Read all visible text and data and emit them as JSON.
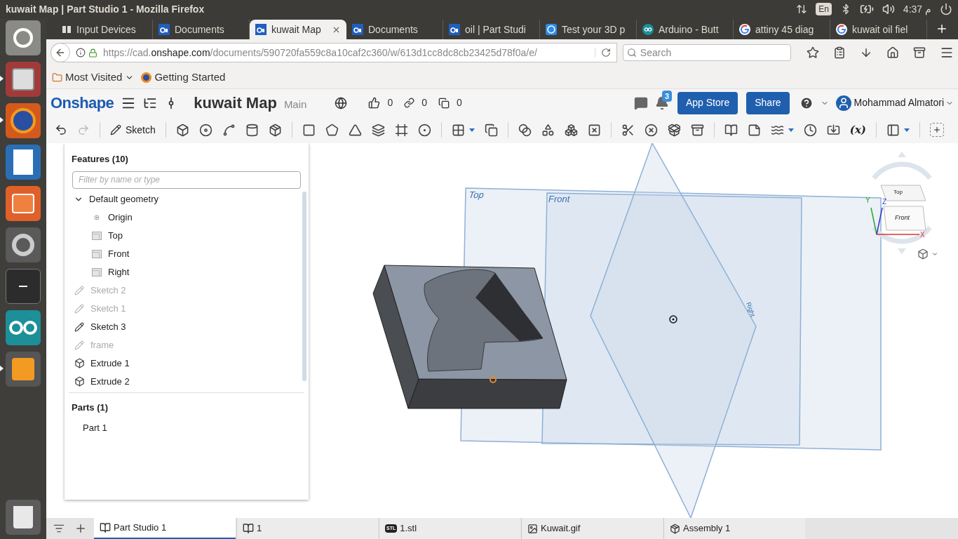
{
  "os_bar": {
    "title": "kuwait Map | Part Studio 1 - Mozilla Firefox",
    "keyboard": "En",
    "clock": "4:37 م"
  },
  "launcher": [
    {
      "kind": "dash",
      "running": false
    },
    {
      "kind": "files",
      "running": true
    },
    {
      "kind": "firefox",
      "running": true
    },
    {
      "kind": "writer",
      "running": false
    },
    {
      "kind": "store",
      "running": false
    },
    {
      "kind": "settings",
      "running": false
    },
    {
      "kind": "terminal",
      "running": false
    },
    {
      "kind": "arduino",
      "running": false
    },
    {
      "kind": "sublime",
      "running": true
    },
    {
      "kind": "trash",
      "running": false
    }
  ],
  "browser_tabs": [
    {
      "label": "Input Devices",
      "kind": "devices",
      "selected": false
    },
    {
      "label": "Documents",
      "kind": "onshape",
      "selected": false
    },
    {
      "label": "kuwait Map",
      "kind": "onshape",
      "selected": true
    },
    {
      "label": "Documents",
      "kind": "onshape",
      "selected": false
    },
    {
      "label": "oil | Part Studi",
      "kind": "onshape",
      "selected": false
    },
    {
      "label": "Test your 3D p",
      "kind": "badge",
      "selected": false
    },
    {
      "label": "Arduino - Butt",
      "kind": "arduino",
      "selected": false
    },
    {
      "label": "attiny 45 diag",
      "kind": "google",
      "selected": false
    },
    {
      "label": "kuwait oil fiel",
      "kind": "google",
      "selected": false
    }
  ],
  "address": {
    "scheme": "https://cad.",
    "host": "onshape.com",
    "path": "/documents/590720fa559c8a10caf2c360/w/613d1cc8dc8cb23425d78f0a/e/"
  },
  "search_placeholder": "Search",
  "bookmarks": [
    "Most Visited",
    "Getting Started"
  ],
  "app": {
    "logo": "Onshape",
    "document": "kuwait Map",
    "workspace": "Main",
    "likes": "0",
    "links": "0",
    "copies": "0",
    "notifications": "3",
    "buttons": [
      "App Store",
      "Share"
    ],
    "user": "Mohammad Almatori"
  },
  "toolbar": {
    "sketch": "Sketch",
    "variable": "(x)"
  },
  "features": {
    "title": "Features (10)",
    "filter_placeholder": "Filter by name or type",
    "items": [
      {
        "label": "Default geometry",
        "kind": "group",
        "expanded": true,
        "children": [
          {
            "label": "Origin",
            "kind": "point"
          },
          {
            "label": "Top",
            "kind": "plane"
          },
          {
            "label": "Front",
            "kind": "plane"
          },
          {
            "label": "Right",
            "kind": "plane"
          }
        ]
      },
      {
        "label": "Sketch 2",
        "kind": "sketch",
        "hidden": true
      },
      {
        "label": "Sketch 1",
        "kind": "sketch",
        "hidden": true
      },
      {
        "label": "Sketch 3",
        "kind": "sketch",
        "hidden": false
      },
      {
        "label": "frame",
        "kind": "sketch",
        "hidden": true
      },
      {
        "label": "Extrude 1",
        "kind": "extrude",
        "hidden": false
      },
      {
        "label": "Extrude 2",
        "kind": "extrude",
        "hidden": false
      }
    ]
  },
  "parts": {
    "title": "Parts (1)",
    "items": [
      "Part 1"
    ]
  },
  "viewport": {
    "planes": [
      "Top",
      "Front",
      "Right"
    ],
    "view_cube": {
      "faces": [
        "Top",
        "Front"
      ],
      "axes": [
        "X",
        "Y",
        "Z"
      ]
    }
  },
  "bottom_tabs": [
    {
      "label": "Part Studio 1",
      "kind": "partstudio",
      "selected": true
    },
    {
      "label": "1",
      "kind": "partstudio",
      "selected": false
    },
    {
      "label": "1.stl",
      "kind": "stl",
      "badge": "STL",
      "selected": false
    },
    {
      "label": "Kuwait.gif",
      "kind": "image",
      "selected": false
    },
    {
      "label": "Assembly 1",
      "kind": "assembly",
      "selected": false
    }
  ]
}
